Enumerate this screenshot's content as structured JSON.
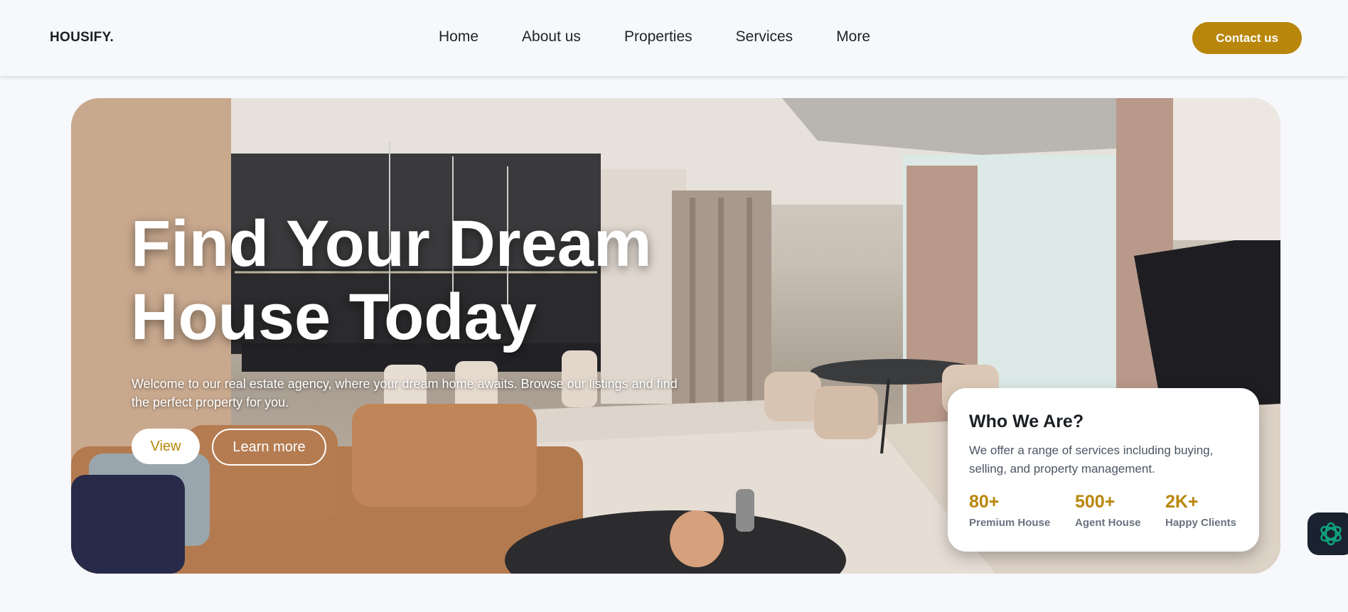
{
  "header": {
    "logo": "HOUSIFY.",
    "nav": [
      "Home",
      "About us",
      "Properties",
      "Services",
      "More"
    ],
    "contact_label": "Contact us"
  },
  "hero": {
    "title_line1": "Find Your Dream",
    "title_line2": "House Today",
    "subtitle": "Welcome to our real estate agency, where your dream home awaits. Browse our listings and find the perfect property for you.",
    "view_label": "View",
    "learn_label": "Learn more"
  },
  "card": {
    "title": "Who We Are?",
    "text": "We offer a range of services including buying, selling, and property management.",
    "stats": [
      {
        "value": "80+",
        "label": "Premium House"
      },
      {
        "value": "500+",
        "label": "Agent House"
      },
      {
        "value": "2K+",
        "label": "Happy Clients"
      }
    ]
  },
  "colors": {
    "accent": "#b8860b",
    "background": "#f6f8fb",
    "fab": "#1a2230",
    "fab_icon": "#10a37f"
  },
  "icons": {
    "fab": "chat-assistant-icon"
  }
}
